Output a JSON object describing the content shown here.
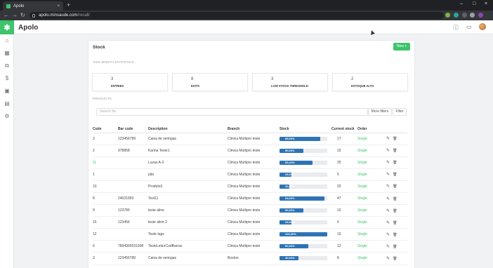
{
  "browser": {
    "tab_title": "Apolo",
    "tab_close": "×",
    "new_tab": "+",
    "url_host": "apolo.minsaude.com",
    "url_path": "/recall/"
  },
  "app": {
    "logo_glyph": "✱",
    "name": "Apolo"
  },
  "page": {
    "title": "Stock",
    "new_button": "New +",
    "stats_label": "THIS MONTH STATISTICS",
    "stats": [
      {
        "value": "3",
        "label": "ENTRIES"
      },
      {
        "value": "8",
        "label": "EXITS"
      },
      {
        "value": "3",
        "label": "LOW STOCK THRESHOLD"
      },
      {
        "value": "2",
        "label": "ESTOQUE ALTO"
      }
    ],
    "products_label": "PRODUCTS",
    "search_placeholder": "Search for...",
    "more_filters": "More filters",
    "filter": "Filter"
  },
  "table": {
    "headers": [
      "Code",
      "Bar code",
      "Description",
      "Branch",
      "Stock",
      "Current stock",
      "Order",
      ""
    ],
    "rows": [
      {
        "code": "3",
        "barcode": "123456789",
        "desc": "Caixa de seringas",
        "branch": "Clinica Multipro teste",
        "stock_pct": 85,
        "stock_label": "85,00%",
        "current": "17",
        "order": "Single"
      },
      {
        "code": "2",
        "barcode": "978858",
        "desc": "Karina Teste1",
        "branch": "Clinica Multipro teste",
        "stock_pct": 50,
        "stock_label": "50,00%",
        "current": "15",
        "order": "Single"
      },
      {
        "code": "11",
        "barcode": "",
        "desc": "Luvas A-3",
        "branch": "Clinica Multipro teste",
        "stock_pct": 69.44,
        "stock_label": "69,44%",
        "current": "25",
        "order": "Single"
      },
      {
        "code": "1",
        "barcode": "",
        "desc": "pão",
        "branch": "Clinica Multipro teste",
        "stock_pct": 25,
        "stock_label": "25,00%",
        "current": "5",
        "order": "Single"
      },
      {
        "code": "10",
        "barcode": "",
        "desc": "Produto3",
        "branch": "Clinica Multipro teste",
        "stock_pct": 20,
        "stock_label": "20,00%",
        "current": "20",
        "order": "Single"
      },
      {
        "code": "8",
        "barcode": "24031993",
        "desc": "Test11",
        "branch": "Clinica Multipro teste",
        "stock_pct": 94,
        "stock_label": "94,00%",
        "current": "47",
        "order": "Single"
      },
      {
        "code": "9",
        "barcode": "123789",
        "desc": "teste aline",
        "branch": "Clinica Multipro teste",
        "stock_pct": 50,
        "stock_label": "50,00%",
        "current": "10",
        "order": "Single"
      },
      {
        "code": "15",
        "barcode": "123456",
        "desc": "teste aline 2",
        "branch": "Clinica Multipro teste",
        "stock_pct": 25,
        "stock_label": "25,00%",
        "current": "6",
        "order": "Single"
      },
      {
        "code": "12",
        "barcode": "",
        "desc": "Teste tags",
        "branch": "Clinica Multipro teste",
        "stock_pct": 100,
        "stock_label": "100,00%",
        "current": "10",
        "order": "Single"
      },
      {
        "code": "6",
        "barcode": "7894900531008",
        "desc": "TesteLeitorCodBarras",
        "branch": "Clinica Multipro teste",
        "stock_pct": 60,
        "stock_label": "60,00%",
        "current": "12",
        "order": "Single"
      },
      {
        "code": "3",
        "barcode": "123456789",
        "desc": "Caixa de seringas",
        "branch": "Boston",
        "stock_pct": 40,
        "stock_label": "40,00%",
        "current": "8",
        "order": "Single"
      },
      {
        "code": "10",
        "barcode": "",
        "desc": "Produto3",
        "branch": "Boston",
        "stock_pct": 20,
        "stock_label": "20,00%",
        "current": "20",
        "order": "Single"
      }
    ]
  },
  "icons": {
    "edit": "✎",
    "delete": "🗑"
  },
  "colors": {
    "brand_green": "#3ec46d",
    "bar_blue": "#2e74b5"
  }
}
